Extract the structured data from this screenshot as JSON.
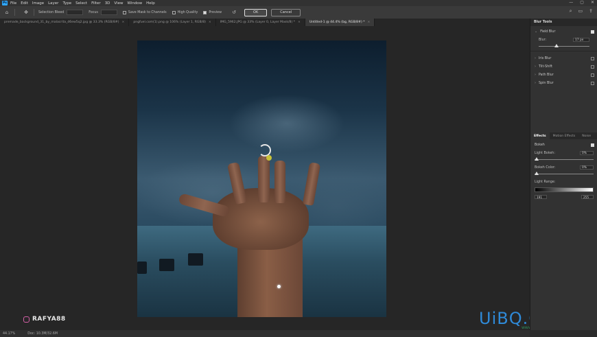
{
  "menu": {
    "logo": "Ps",
    "items": [
      "File",
      "Edit",
      "Image",
      "Layer",
      "Type",
      "Select",
      "Filter",
      "3D",
      "View",
      "Window",
      "Help"
    ],
    "window_controls": [
      "—",
      "▢",
      "✕"
    ]
  },
  "options": {
    "selection_bleed_label": "Selection Bleed",
    "focus_label": "Focus",
    "save_mask_label": "Save Mask to Channels",
    "high_quality_label": "High Quality",
    "preview_label": "Preview",
    "preview_checked": true,
    "ok_label": "OK",
    "cancel_label": "Cancel"
  },
  "tabs": [
    {
      "label": "premade_background_31_by_malacrita_d6ew5q2.jpg @ 33.3% (RGB/8#)",
      "active": false
    },
    {
      "label": "pngfuel.com(1).png @ 106% (Layer 1, RGB/8)",
      "active": false
    },
    {
      "label": "IMG_5962.JPG @ 33% (Layer 0, Layer Mask/8) *",
      "active": false
    },
    {
      "label": "Untitled-1 @ 44.4% (bg, RGB/8#) *",
      "active": true
    }
  ],
  "watermark": {
    "handle": "RAFYA88"
  },
  "site_logo": {
    "text": "UiBQ.CoM",
    "url": "www.psahz.com"
  },
  "status": {
    "zoom": "44.17%",
    "doc": "Doc: 10.3M/32.6M"
  },
  "blur_tools": {
    "title": "Blur Tools",
    "field_blur": {
      "label": "Field Blur",
      "checked": true,
      "blur_label": "Blur:",
      "blur_value": "17 px",
      "slider_fraction": 0.35
    },
    "others": [
      {
        "label": "Iris Blur",
        "checked": false
      },
      {
        "label": "Tilt-Shift",
        "checked": false
      },
      {
        "label": "Path Blur",
        "checked": false
      },
      {
        "label": "Spin Blur",
        "checked": false
      }
    ]
  },
  "effects": {
    "tabs": [
      "Effects",
      "Motion Effects",
      "Noise"
    ],
    "bokeh_label": "Bokeh",
    "bokeh_checked": true,
    "light_bokeh_label": "Light Bokeh:",
    "light_bokeh_value": "0%",
    "bokeh_color_label": "Bokeh Color:",
    "bokeh_color_value": "0%",
    "light_range_label": "Light Range:",
    "range_low": "191",
    "range_high": "255"
  }
}
